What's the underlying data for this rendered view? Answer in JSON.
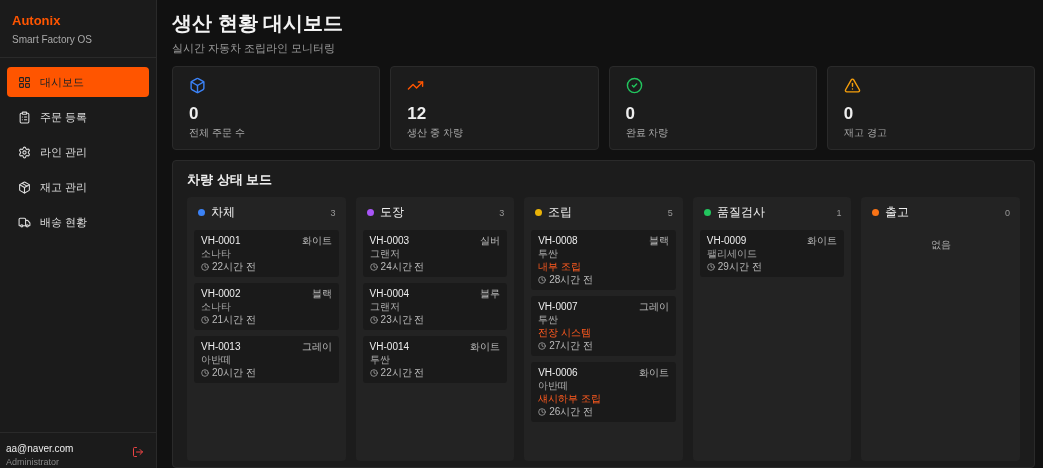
{
  "brand": {
    "name": "Autonix",
    "subtitle": "Smart Factory OS"
  },
  "nav": [
    {
      "label": "대시보드",
      "selected": true
    },
    {
      "label": "주문 등록",
      "selected": false
    },
    {
      "label": "라인 관리",
      "selected": false
    },
    {
      "label": "재고 관리",
      "selected": false
    },
    {
      "label": "배송 현황",
      "selected": false
    }
  ],
  "user": {
    "email": "aa@naver.com",
    "role": "Administrator"
  },
  "header": {
    "title": "생산 현황 대시보드",
    "subtitle": "실시간 자동차 조립라인 모니터링"
  },
  "stats": [
    {
      "kind": "box",
      "value": "0",
      "label": "전체 주문 수"
    },
    {
      "kind": "trend",
      "value": "12",
      "label": "생산 중 차량"
    },
    {
      "kind": "check",
      "value": "0",
      "label": "완료 차량"
    },
    {
      "kind": "warning",
      "value": "0",
      "label": "재고 경고"
    }
  ],
  "board": {
    "title": "차량 상태 보드",
    "empty_text": "없음",
    "columns": [
      {
        "name": "차체",
        "color": "#3b82f6",
        "count": "3",
        "cards": [
          {
            "id": "VH-0001",
            "color_name": "화이트",
            "model": "소나타",
            "time": "22시간 전"
          },
          {
            "id": "VH-0002",
            "color_name": "블랙",
            "model": "소나타",
            "time": "21시간 전"
          },
          {
            "id": "VH-0013",
            "color_name": "그레이",
            "model": "아반떼",
            "time": "20시간 전"
          }
        ]
      },
      {
        "name": "도장",
        "color": "#a855f7",
        "count": "3",
        "cards": [
          {
            "id": "VH-0003",
            "color_name": "실버",
            "model": "그랜저",
            "time": "24시간 전"
          },
          {
            "id": "VH-0004",
            "color_name": "블루",
            "model": "그랜저",
            "time": "23시간 전"
          },
          {
            "id": "VH-0014",
            "color_name": "화이트",
            "model": "투싼",
            "time": "22시간 전"
          }
        ]
      },
      {
        "name": "조립",
        "color": "#eab308",
        "count": "5",
        "cards": [
          {
            "id": "VH-0008",
            "color_name": "블랙",
            "model": "투싼",
            "process": "내부 조립",
            "time": "28시간 전"
          },
          {
            "id": "VH-0007",
            "color_name": "그레이",
            "model": "투싼",
            "process": "전장 시스템",
            "time": "27시간 전"
          },
          {
            "id": "VH-0006",
            "color_name": "화이트",
            "model": "아반떼",
            "process": "섀시하부 조립",
            "time": "26시간 전"
          }
        ]
      },
      {
        "name": "품질검사",
        "color": "#22c55e",
        "count": "1",
        "cards": [
          {
            "id": "VH-0009",
            "color_name": "화이트",
            "model": "팰리세이드",
            "time": "29시간 전"
          }
        ]
      },
      {
        "name": "출고",
        "color": "#f97316",
        "count": "0"
      }
    ]
  }
}
